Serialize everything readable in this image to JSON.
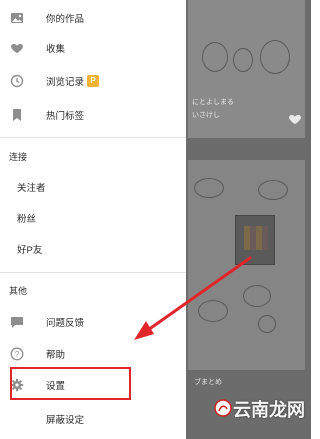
{
  "drawer": {
    "menu": [
      {
        "label": "你的作品",
        "icon": "image-icon"
      },
      {
        "label": "收集",
        "icon": "heart-icon"
      },
      {
        "label": "浏览记录",
        "icon": "clock-icon",
        "badge": "P"
      },
      {
        "label": "热门标签",
        "icon": "bookmark-icon"
      }
    ],
    "connect_header": "连接",
    "connect_items": [
      "关注者",
      "粉丝",
      "好P友"
    ],
    "other_header": "其他",
    "other_items": [
      {
        "label": "问题反馈",
        "icon": "chat-icon"
      },
      {
        "label": "帮助",
        "icon": "help-icon"
      },
      {
        "label": "设置",
        "icon": "gear-icon"
      },
      {
        "label": "屏蔽设定"
      }
    ]
  },
  "background": {
    "caption_line1": "にとよしまる",
    "caption_line2": "いさけし",
    "caption_bottom": "ブまとめ"
  },
  "watermark": "云南龙网",
  "colors": {
    "highlight": "#e0262a",
    "badge": "#f2b233",
    "icon": "#8e8e8e"
  }
}
